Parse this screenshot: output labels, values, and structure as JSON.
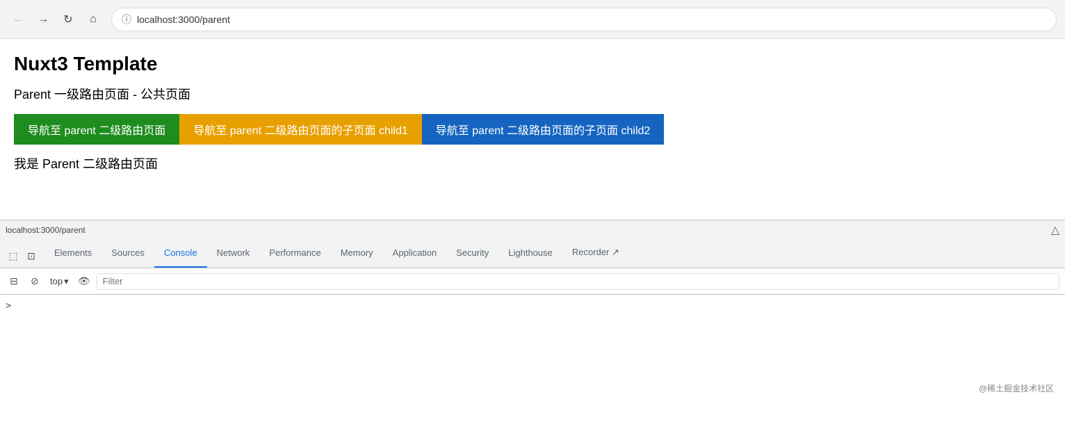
{
  "browser": {
    "url": "localhost:3000/parent",
    "back_disabled": true,
    "forward_disabled": true
  },
  "page": {
    "title": "Nuxt3 Template",
    "subtitle": "Parent 一级路由页面 - 公共页面",
    "nav_btn1": "导航至 parent 二级路由页面",
    "nav_btn2": "导航至 parent 二级路由页面的子页面 child1",
    "nav_btn3": "导航至 parent 二级路由页面的子页面 child2",
    "info": "我是 Parent 二级路由页面"
  },
  "devtools": {
    "status_url": "localhost:3000/parent",
    "tabs": [
      {
        "label": "Elements",
        "active": false
      },
      {
        "label": "Sources",
        "active": false
      },
      {
        "label": "Console",
        "active": true
      },
      {
        "label": "Network",
        "active": false
      },
      {
        "label": "Performance",
        "active": false
      },
      {
        "label": "Memory",
        "active": false
      },
      {
        "label": "Application",
        "active": false
      },
      {
        "label": "Security",
        "active": false
      },
      {
        "label": "Lighthouse",
        "active": false
      },
      {
        "label": "Recorder ↗",
        "active": false
      }
    ],
    "console": {
      "top_label": "top",
      "filter_placeholder": "Filter",
      "caret": ">"
    }
  },
  "watermark": "@稀土掘金技术社区",
  "icons": {
    "back": "←",
    "forward": "→",
    "reload": "↻",
    "home": "⌂",
    "info": "ⓘ",
    "inspect": "⬚",
    "device": "⊡",
    "clear": "🚫",
    "eye": "👁",
    "chevron_down": "▾",
    "sidebar_toggle": "⊟",
    "drawer": "⬛",
    "triangle": "△"
  }
}
